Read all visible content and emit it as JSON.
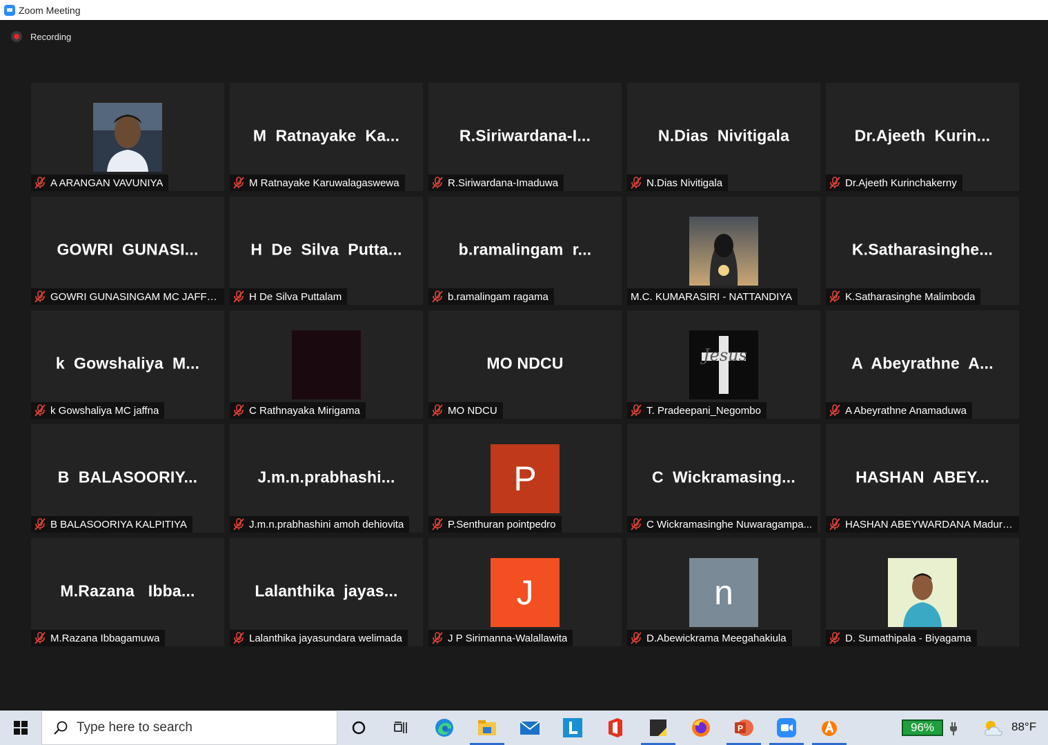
{
  "window": {
    "title": "Zoom Meeting"
  },
  "recording": {
    "label": "Recording"
  },
  "participants": [
    {
      "name": "A ARANGAN VAVUNIYA",
      "display": "",
      "avatar": "photo-man",
      "muted": true
    },
    {
      "name": "M Ratnayake Karuwalagaswewa",
      "display": "M  Ratnayake  Ka...",
      "muted": true
    },
    {
      "name": "R.Siriwardana-Imaduwa",
      "display": "R.Siriwardana-I...",
      "muted": true
    },
    {
      "name": "N.Dias Nivitigala",
      "display": "N.Dias  Nivitigala",
      "muted": true
    },
    {
      "name": "Dr.Ajeeth Kurinchakerny",
      "display": "Dr.Ajeeth  Kurin...",
      "muted": true
    },
    {
      "name": "GOWRI GUNASINGAM MC JAFFNA",
      "display": "GOWRI  GUNASI...",
      "muted": true
    },
    {
      "name": "H De Silva Puttalam",
      "display": "H  De  Silva  Putta...",
      "muted": true
    },
    {
      "name": "b.ramalingam ragama",
      "display": "b.ramalingam  r...",
      "muted": true
    },
    {
      "name": "M.C. KUMARASIRI - NATTANDIYA",
      "display": "",
      "avatar": "photo-hooded",
      "muted": false
    },
    {
      "name": "K.Satharasinghe Malimboda",
      "display": "K.Satharasinghe...",
      "muted": true
    },
    {
      "name": "k Gowshaliya MC jaffna",
      "display": "k  Gowshaliya  M...",
      "muted": true
    },
    {
      "name": "C Rathnayaka Mirigama",
      "display": "",
      "avatar": "photo-dark",
      "muted": true
    },
    {
      "name": "MO NDCU",
      "display": "MO NDCU",
      "muted": true
    },
    {
      "name": "T. Pradeepani_Negombo",
      "display": "",
      "avatar": "photo-cross",
      "avatar_text": "Jesus",
      "muted": true
    },
    {
      "name": "A Abeyrathne Anamaduwa",
      "display": "A  Abeyrathne  A...",
      "muted": true
    },
    {
      "name": "B BALASOORIYA KALPITIYA",
      "display": "B  BALASOORIY...",
      "muted": true
    },
    {
      "name": "J.m.n.prabhashini amoh dehiovita",
      "display": "J.m.n.prabhashi...",
      "muted": true
    },
    {
      "name": "P.Senthuran pointpedro",
      "display": "",
      "avatar": "letter",
      "letter": "P",
      "color": "#c0391b",
      "muted": true
    },
    {
      "name": "C Wickramasinghe Nuwaragampa...",
      "display": "C  Wickramasing...",
      "muted": true
    },
    {
      "name": "HASHAN ABEYWARDANA Madura...",
      "display": "HASHAN  ABEY...",
      "muted": true
    },
    {
      "name": "M.Razana  Ibbagamuwa",
      "display": "M.Razana   Ibba...",
      "muted": true
    },
    {
      "name": "Lalanthika jayasundara welimada",
      "display": "Lalanthika  jayas...",
      "muted": true
    },
    {
      "name": "J P Sirimanna-Walallawita",
      "display": "",
      "avatar": "letter",
      "letter": "J",
      "color": "#f25022",
      "muted": true
    },
    {
      "name": "D.Abewickrama Meegahakiula",
      "display": "",
      "avatar": "letter",
      "letter": "n",
      "color": "#7a8a96",
      "muted": true
    },
    {
      "name": "D. Sumathipala - Biyagama",
      "display": "",
      "avatar": "photo-smile",
      "muted": true
    }
  ],
  "taskbar": {
    "search_placeholder": "Type here to search",
    "battery": "96%",
    "temperature": "88°F",
    "apps": [
      "cortana-icon",
      "task-view-icon",
      "edge-icon",
      "file-explorer-icon",
      "mail-icon",
      "l-app-icon",
      "office-icon",
      "sticky-notes-icon",
      "firefox-icon",
      "powerpoint-icon",
      "zoom-icon",
      "avast-icon"
    ]
  }
}
